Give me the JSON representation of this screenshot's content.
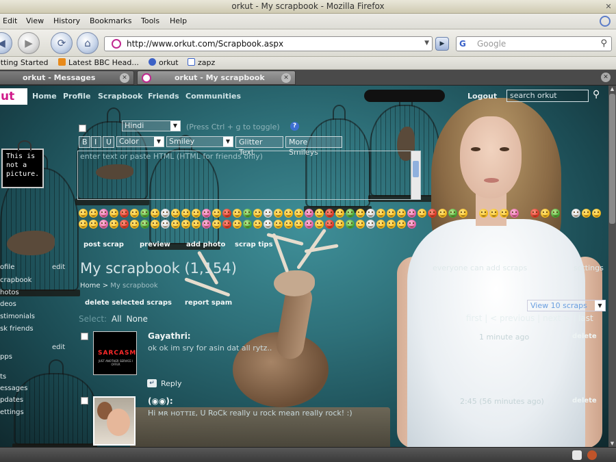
{
  "window": {
    "title": "orkut - My scrapbook - Mozilla Firefox"
  },
  "menu": {
    "items": [
      "Edit",
      "View",
      "History",
      "Bookmarks",
      "Tools",
      "Help"
    ]
  },
  "navbar": {
    "url": "http://www.orkut.com/Scrapbook.aspx",
    "search_placeholder": "Google",
    "search_engine_letter": "G"
  },
  "bookmarks": {
    "items": [
      "etting Started",
      "Latest BBC Head...",
      "orkut",
      "zapz"
    ]
  },
  "tabs": [
    {
      "label": "orkut - Messages",
      "active": false
    },
    {
      "label": "orkut - My scrapbook",
      "active": true
    }
  ],
  "orkut": {
    "logo": "ut",
    "nav": [
      "Home",
      "Profile",
      "Scrapbook",
      "Friends",
      "Communities"
    ],
    "logout": "Logout",
    "search_placeholder": "search orkut"
  },
  "left": {
    "not_picture": "This is not a picture.",
    "items": [
      "ofile",
      "crapbook",
      "hotos",
      "deos",
      "stimonials",
      "sk friends",
      "pps",
      "ts",
      "essages",
      "pdates",
      "ettings"
    ],
    "edit": "edit"
  },
  "composer": {
    "language": "Hindi",
    "hint": "(Press Ctrl + g to toggle)",
    "bold": "B",
    "italic": "I",
    "underline": "U",
    "color": "Color",
    "smiley": "Smiley",
    "glitter": "Glitter Text",
    "more_smileys": "More Smileys",
    "placeholder": "enter text or paste HTML (HTML for friends only)"
  },
  "actions": {
    "post_scrap": "post scrap",
    "preview": "preview",
    "add_photo": "add photo",
    "scrap_tips": "scrap tips"
  },
  "scrapbook": {
    "title": "My scrapbook (1,154)",
    "crumb_home": "Home",
    "crumb_sep": ">",
    "crumb_current": "My scrapbook",
    "everyone": "everyone can add scraps",
    "settings": "settings",
    "delete_selected": "delete selected scraps",
    "report_spam": "report spam",
    "view": "View 10 scraps",
    "select_label": "Select:",
    "select_all": "All",
    "select_none": "None",
    "pager": "first  |  < previous  |  next >  |  last"
  },
  "scraps": [
    {
      "name": "Gayathri:",
      "text": "ok ok im sry for asin dat all rytz..",
      "time": "1 minute ago",
      "delete": "delete",
      "avatar_text": "SARCASM",
      "avatar_sub": "JUST ANOTHER SERVICE I OFFER"
    },
    {
      "name": "(◉◉):",
      "text": "Hi ᴍʀ ʜᴏᴛᴛɪᴇ, U RoCk really u rock mean really rock! :)",
      "time": "2:45 (56 minutes ago)",
      "delete": "delete"
    }
  ],
  "reply": "Reply"
}
